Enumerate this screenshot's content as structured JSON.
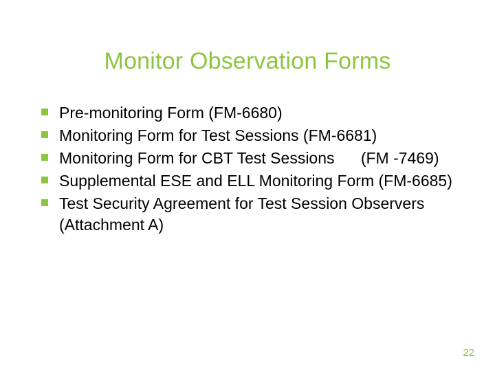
{
  "slide": {
    "title": "Monitor Observation Forms",
    "bullets": [
      "Pre-monitoring Form (FM-6680)",
      "Monitoring Form for Test Sessions (FM-6681)",
      "Monitoring Form for CBT Test Sessions      (FM -7469)",
      "Supplemental ESE and ELL Monitoring Form (FM-6685)",
      "Test Security Agreement for Test Session Observers (Attachment A)"
    ],
    "page_number": "22"
  }
}
